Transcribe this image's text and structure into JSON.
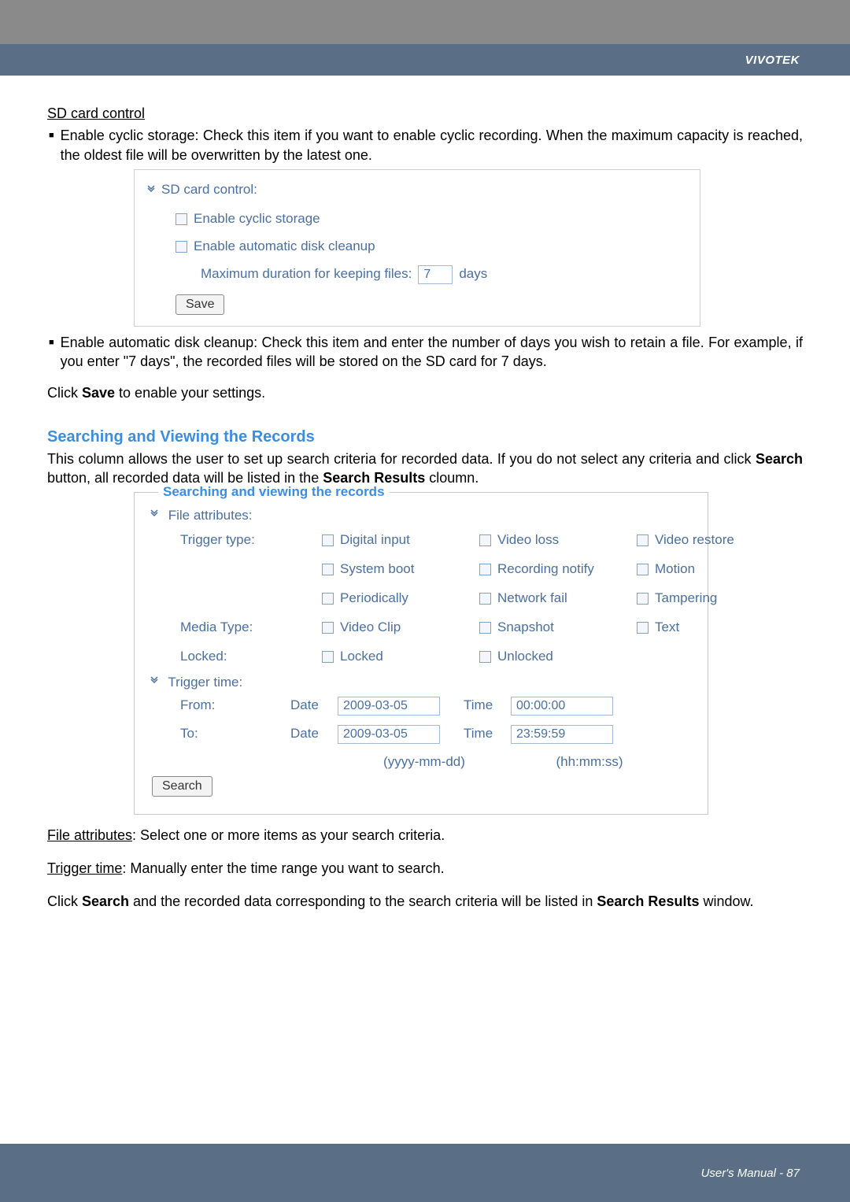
{
  "brand": "VIVOTEK",
  "sd_card": {
    "heading": "SD card control",
    "bullet1": "Enable cyclic storage: Check this item if you want to enable cyclic recording. When the maximum capacity is reached, the oldest file will be overwritten by the latest one.",
    "bullet2": "Enable automatic disk cleanup: Check this item and enter the number of days you wish to retain a file. For example, if you enter \"7 days\", the recorded files will be stored on the SD card for 7 days.",
    "save_line": "Click Save to enable your settings.",
    "panel": {
      "title": "SD card control:",
      "enable_cyclic": "Enable cyclic storage",
      "enable_cleanup": "Enable automatic disk cleanup",
      "max_duration_label": "Maximum duration for keeping files:",
      "max_duration_value": "7",
      "days": "days",
      "save": "Save"
    }
  },
  "search_section": {
    "title": "Searching and Viewing the Records",
    "intro": "This column allows the user to set up search criteria for recorded data. If you do not select any criteria and click Search button, all recorded data will be listed in the Search Results cloumn.",
    "legend": "Searching and viewing the records",
    "file_attributes": "File attributes:",
    "trigger_type": "Trigger type:",
    "media_type": "Media Type:",
    "locked_label": "Locked:",
    "cb": {
      "digital_input": "Digital input",
      "video_loss": "Video loss",
      "video_restore": "Video restore",
      "system_boot": "System boot",
      "recording_notify": "Recording notify",
      "motion": "Motion",
      "periodically": "Periodically",
      "network_fail": "Network fail",
      "tampering": "Tampering",
      "video_clip": "Video Clip",
      "snapshot": "Snapshot",
      "text": "Text",
      "locked": "Locked",
      "unlocked": "Unlocked"
    },
    "trigger_time": "Trigger time:",
    "from": "From:",
    "to": "To:",
    "date_label": "Date",
    "time_label": "Time",
    "from_date": "2009-03-05",
    "from_time": "00:00:00",
    "to_date": "2009-03-05",
    "to_time": "23:59:59",
    "date_hint": "(yyyy-mm-dd)",
    "time_hint": "(hh:mm:ss)",
    "search_btn": "Search"
  },
  "post_text": {
    "file_attr_label": "File attributes",
    "file_attr_rest": ": Select one or more items as your search criteria.",
    "trigger_time_label": "Trigger time",
    "trigger_time_rest": ": Manually enter the time range you want to search.",
    "search_line_pre": "Click ",
    "search_bold": "Search",
    "search_line_mid": " and the recorded data corresponding to the search criteria will be listed in ",
    "search_results_bold": "Search Results",
    "search_line_end": " window."
  },
  "footer": "User's Manual - 87"
}
